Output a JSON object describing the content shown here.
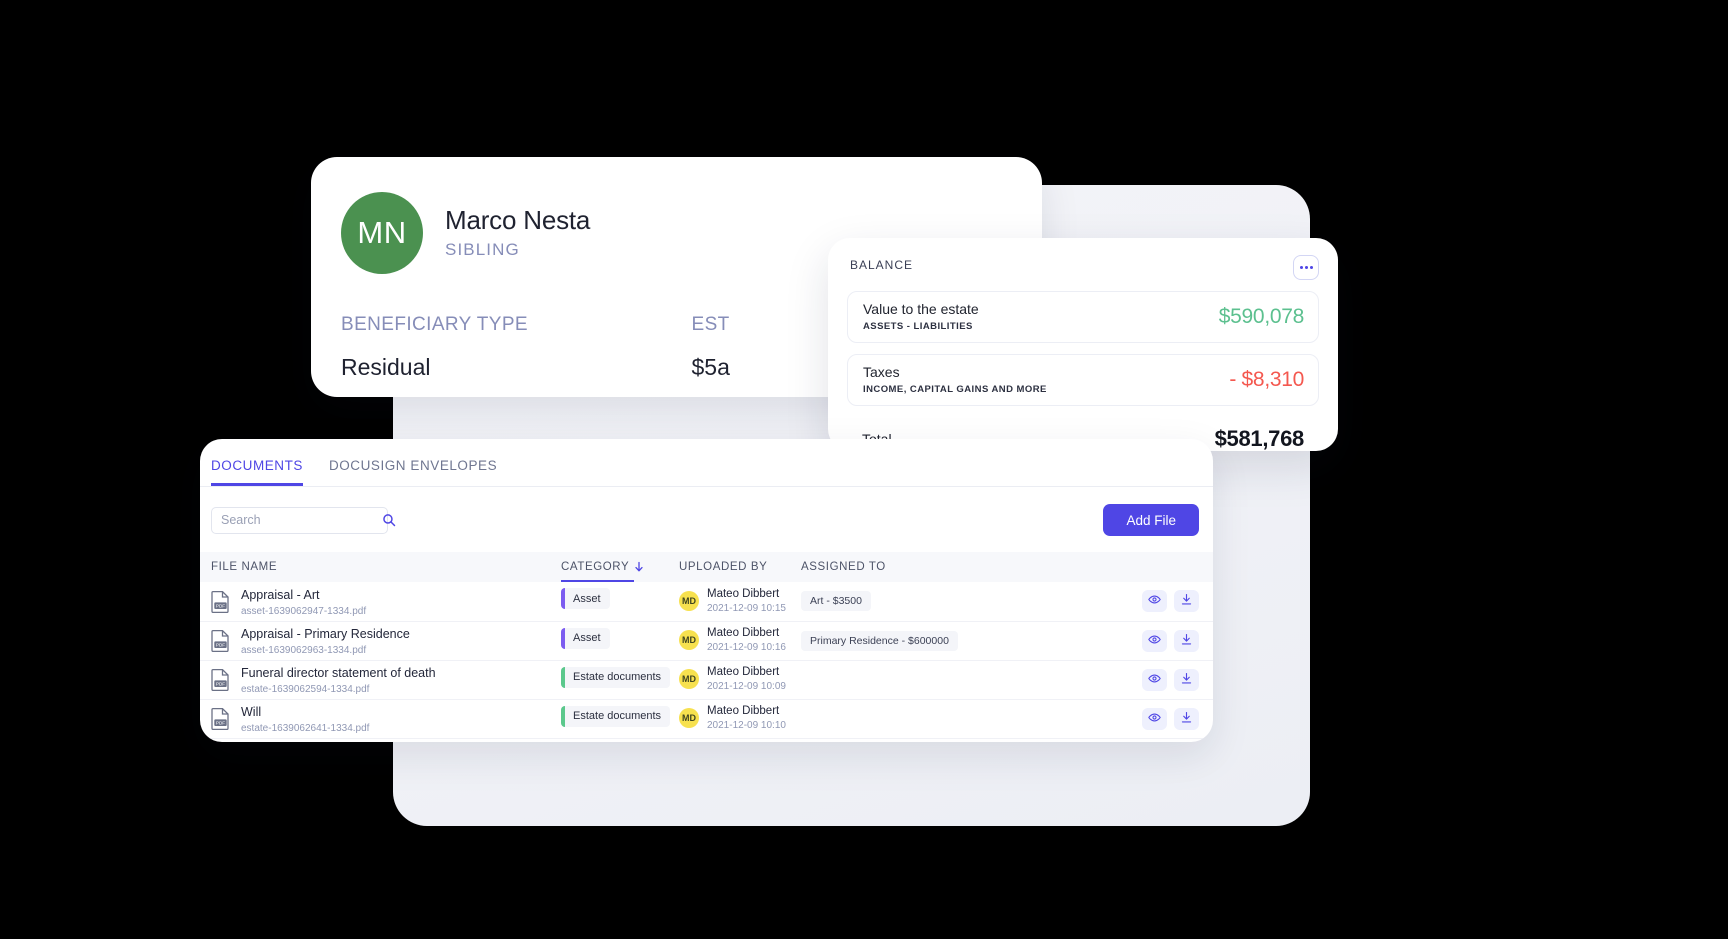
{
  "profile": {
    "avatar_initials": "MN",
    "avatar_color": "#4b9150",
    "name": "Marco Nesta",
    "relation": "SIBLING",
    "fields": [
      {
        "label": "BENEFICIARY TYPE",
        "value": "Residual"
      },
      {
        "label": "EST",
        "value": "$5a"
      }
    ]
  },
  "balance": {
    "title": "BALANCE",
    "menu_icon": "more-horizontal-icon",
    "rows": [
      {
        "name": "Value to the estate",
        "sub": "ASSETS - LIABILITIES",
        "amount": "$590,078",
        "amount_color": "#5cc08f"
      },
      {
        "name": "Taxes",
        "sub": "INCOME, CAPITAL GAINS AND MORE",
        "amount": "- $8,310",
        "amount_color": "#f4584f"
      }
    ],
    "total": {
      "name": "Total",
      "amount": "$581,768"
    }
  },
  "documents": {
    "tabs": [
      {
        "label": "DOCUMENTS",
        "active": true
      },
      {
        "label": "DOCUSIGN ENVELOPES",
        "active": false
      }
    ],
    "search": {
      "placeholder": "Search",
      "value": "",
      "icon": "search-icon"
    },
    "add_file_label": "Add File",
    "accent_color": "#4f46e5",
    "columns": [
      {
        "label": "FILE NAME",
        "sorted": false
      },
      {
        "label": "CATEGORY",
        "sorted": true,
        "sort_icon": "arrow-down-icon"
      },
      {
        "label": "UPLOADED BY",
        "sorted": false
      },
      {
        "label": "ASSIGNED TO",
        "sorted": false
      },
      {
        "label": "",
        "sorted": false
      }
    ],
    "rows": [
      {
        "file_name": "Appraisal - Art",
        "file_sub": "asset-1639062947-1334.pdf",
        "file_icon": "pdf-file-icon",
        "category": "Asset",
        "category_color": "#7c5cf0",
        "uploaded_by": "Mateo Dibbert",
        "uploaded_initials": "MD",
        "uploaded_at": "2021-12-09 10:15",
        "assigned_to": "Art - $3500"
      },
      {
        "file_name": "Appraisal - Primary Residence",
        "file_sub": "asset-1639062963-1334.pdf",
        "file_icon": "pdf-file-icon",
        "category": "Asset",
        "category_color": "#7c5cf0",
        "uploaded_by": "Mateo Dibbert",
        "uploaded_initials": "MD",
        "uploaded_at": "2021-12-09 10:16",
        "assigned_to": "Primary Residence - $600000"
      },
      {
        "file_name": "Funeral director statement of death",
        "file_sub": "estate-1639062594-1334.pdf",
        "file_icon": "pdf-file-icon",
        "category": "Estate documents",
        "category_color": "#5bc88c",
        "uploaded_by": "Mateo Dibbert",
        "uploaded_initials": "MD",
        "uploaded_at": "2021-12-09 10:09",
        "assigned_to": ""
      },
      {
        "file_name": "Will",
        "file_sub": "estate-1639062641-1334.pdf",
        "file_icon": "pdf-file-icon",
        "category": "Estate documents",
        "category_color": "#5bc88c",
        "uploaded_by": "Mateo Dibbert",
        "uploaded_initials": "MD",
        "uploaded_at": "2021-12-09 10:10",
        "assigned_to": ""
      }
    ],
    "row_actions": [
      {
        "icon": "eye-icon",
        "name": "view-document-button"
      },
      {
        "icon": "download-icon",
        "name": "download-document-button"
      }
    ]
  }
}
